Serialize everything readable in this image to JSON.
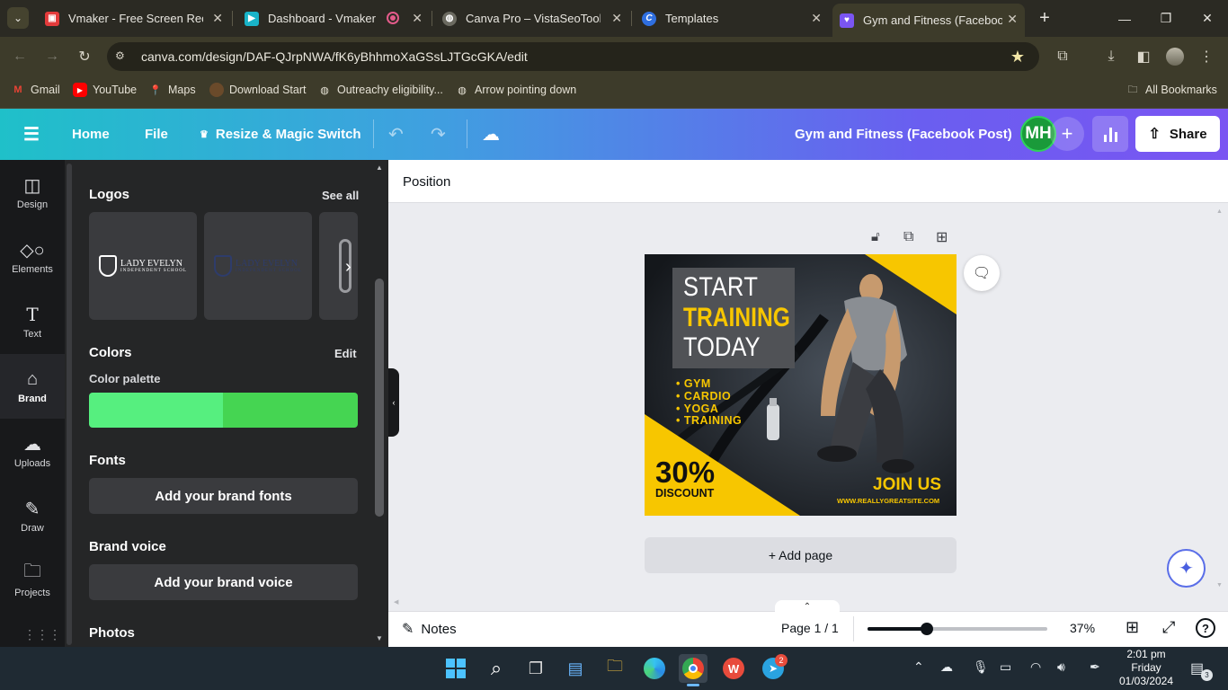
{
  "browser": {
    "tabs": [
      {
        "title": "Vmaker - Free Screen Recorder",
        "icon": "vmaker-icon",
        "color": "#e33b3b"
      },
      {
        "title": "Dashboard - Vmaker",
        "icon": "vmaker-dashboard-icon",
        "color": "#19b3c8"
      },
      {
        "title": "Canva Pro – VistaSeoTools| SEO",
        "icon": "globe-icon",
        "color": "#888888"
      },
      {
        "title": "Templates",
        "icon": "canva-icon",
        "color": "#2f6fe0"
      },
      {
        "title": "Gym and Fitness (Facebook Post)",
        "icon": "canva-heart-icon",
        "color": "#7a55f2"
      }
    ],
    "url": "canva.com/design/DAF-QJrpNWA/fK6yBhhmoXaGSsLJTGcGKA/edit",
    "bookmarks": [
      {
        "label": "Gmail",
        "icon": "gmail-icon"
      },
      {
        "label": "YouTube",
        "icon": "youtube-icon"
      },
      {
        "label": "Maps",
        "icon": "maps-icon"
      },
      {
        "label": "Download Start",
        "icon": "avatar-icon"
      },
      {
        "label": "Outreachy eligibility...",
        "icon": "globe-icon"
      },
      {
        "label": "Arrow pointing down",
        "icon": "globe-icon"
      }
    ],
    "all_bookmarks": "All Bookmarks"
  },
  "canva_header": {
    "home": "Home",
    "file": "File",
    "resize": "Resize & Magic Switch",
    "doc_title": "Gym and Fitness (Facebook Post)",
    "avatar_initials": "MH",
    "share": "Share"
  },
  "rail": [
    {
      "label": "Design",
      "icon": "design-icon"
    },
    {
      "label": "Elements",
      "icon": "elements-icon"
    },
    {
      "label": "Text",
      "icon": "text-icon"
    },
    {
      "label": "Brand",
      "icon": "brand-icon",
      "active": true
    },
    {
      "label": "Uploads",
      "icon": "uploads-icon"
    },
    {
      "label": "Draw",
      "icon": "draw-icon"
    },
    {
      "label": "Projects",
      "icon": "projects-icon"
    }
  ],
  "panel": {
    "logos_title": "Logos",
    "see_all": "See all",
    "logo_text_1": "LADY EVELYN",
    "logo_sub_1": "INDEPENDENT SCHOOL",
    "logo_text_2": "LADY EVELYN",
    "logo_sub_2": "INDEPENDENT SCHOOL",
    "colors_title": "Colors",
    "edit": "Edit",
    "palette_label": "Color palette",
    "palette": [
      "#56ef7f",
      "#45d552"
    ],
    "fonts_title": "Fonts",
    "add_fonts": "Add your brand fonts",
    "voice_title": "Brand voice",
    "add_voice": "Add your brand voice",
    "photos_title": "Photos"
  },
  "workspace": {
    "position": "Position",
    "add_page": "+ Add page",
    "notes": "Notes",
    "page_indicator": "Page 1 / 1",
    "zoom": "37%",
    "zoom_fraction": 0.33
  },
  "design": {
    "line1": "START",
    "line2": "TRAINING",
    "line3": "TODAY",
    "bullets": [
      "GYM",
      "CARDIO",
      "YOGA",
      "TRAINING"
    ],
    "discount_value": "30%",
    "discount_label": "DISCOUNT",
    "join": "JOIN US",
    "website": "WWW.REALLYGREATSITE.COM",
    "accent": "#f7c600"
  },
  "taskbar": {
    "time": "2:01 pm",
    "day": "Friday",
    "date": "01/03/2024",
    "telegram_badge": "2",
    "notif_badge": "3"
  }
}
